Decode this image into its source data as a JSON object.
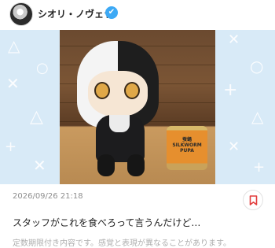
{
  "author": {
    "name": "シオリ・ノヴェラ",
    "verified_mark": "✔"
  },
  "post": {
    "timestamp": "2026/09/26 21:18",
    "title": "スタッフがこれを食べろって言うんだけど…",
    "notice": "定数期限付き内容です。感覚と表現が異なることがあります。"
  },
  "photo": {
    "can_label": "SILKWORM PUPA",
    "can_top": "蚕蛹"
  },
  "icons": {
    "avatar": "avatar-icon",
    "verified": "verified-badge-icon",
    "bookmark": "bookmark-icon"
  },
  "colors": {
    "verified_badge": "#3da9f5",
    "bookmark_red": "#e23c3c",
    "media_background": "#d8eaf7"
  }
}
